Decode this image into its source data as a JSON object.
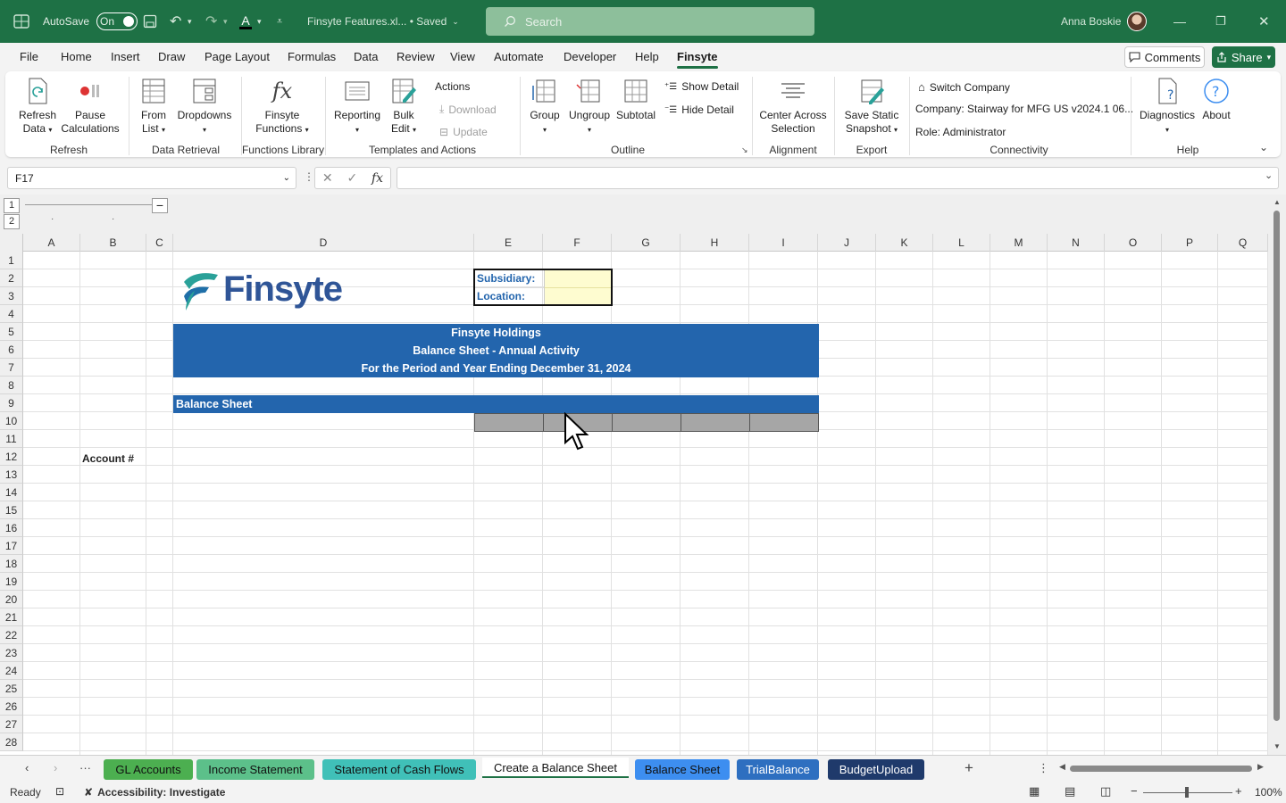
{
  "titlebar": {
    "autosave_label": "AutoSave",
    "autosave_state": "On",
    "filename": "Finsyte Features.xl... • Saved",
    "search_placeholder": "Search",
    "user_name": "Anna Boskie"
  },
  "menu": {
    "tabs": [
      "File",
      "Home",
      "Insert",
      "Draw",
      "Page Layout",
      "Formulas",
      "Data",
      "Review",
      "View",
      "Automate",
      "Developer",
      "Help",
      "Finsyte"
    ],
    "active_tab": "Finsyte",
    "comments_label": "Comments",
    "share_label": "Share"
  },
  "ribbon": {
    "refresh_data": "Refresh Data",
    "pause_calc": "Pause Calculations",
    "group_refresh": "Refresh",
    "from_list": "From List",
    "dropdowns": "Dropdowns",
    "group_data_retrieval": "Data Retrieval",
    "finsyte_functions": "Finsyte Functions",
    "group_functions_library": "Functions Library",
    "reporting": "Reporting",
    "bulk_edit": "Bulk Edit",
    "actions": "Actions",
    "download": "Download",
    "update": "Update",
    "group_templates": "Templates and Actions",
    "group_btn": "Group",
    "ungroup": "Ungroup",
    "subtotal": "Subtotal",
    "show_detail": "Show Detail",
    "hide_detail": "Hide Detail",
    "group_outline": "Outline",
    "center_across": "Center Across Selection",
    "group_alignment": "Alignment",
    "save_static": "Save Static Snapshot",
    "group_export": "Export",
    "switch_company": "Switch Company",
    "company": "Company: Stairway for MFG US v2024.1 06...",
    "role": "Role: Administrator",
    "group_connectivity": "Connectivity",
    "diagnostics": "Diagnostics",
    "about": "About",
    "group_help": "Help"
  },
  "formula_bar": {
    "name_box": "F17",
    "fx": "fx",
    "formula": ""
  },
  "outline_levels": [
    "1",
    "2"
  ],
  "columns": [
    "A",
    "B",
    "C",
    "D",
    "E",
    "F",
    "G",
    "H",
    "I",
    "J",
    "K",
    "L",
    "M",
    "N",
    "O",
    "P",
    "Q"
  ],
  "rows": [
    "1",
    "2",
    "3",
    "4",
    "5",
    "6",
    "7",
    "8",
    "9",
    "10",
    "11",
    "12",
    "13",
    "14",
    "15",
    "16",
    "17",
    "18",
    "19",
    "20",
    "21",
    "22",
    "23",
    "24",
    "25",
    "26",
    "27",
    "28"
  ],
  "sheet": {
    "logo_text": "Finsyte",
    "subsidiary_label": "Subsidiary:",
    "location_label": "Location:",
    "title1": "Finsyte Holdings",
    "title2": "Balance Sheet - Annual Activity",
    "title3": "For the Period and Year Ending December 31, 2024",
    "section": "Balance Sheet",
    "account_header": "Account #"
  },
  "sheet_tabs": [
    {
      "label": "GL Accounts",
      "color": "#4caf50"
    },
    {
      "label": "Income Statement",
      "color": "#5cc08a"
    },
    {
      "label": "Statement of Cash Flows",
      "color": "#40c0b8"
    },
    {
      "label": "Create a Balance Sheet",
      "color": "#ffffff"
    },
    {
      "label": "Balance Sheet",
      "color": "#3d8ef0"
    },
    {
      "label": "TrialBalance",
      "color": "#2e6fc0"
    },
    {
      "label": "BudgetUpload",
      "color": "#1f3a6b"
    }
  ],
  "statusbar": {
    "ready": "Ready",
    "accessibility": "Accessibility: Investigate",
    "zoom": "100%"
  },
  "colors": {
    "excel_green": "#1e7145",
    "banner_blue": "#2365ad",
    "logo_teal": "#2aa199"
  }
}
